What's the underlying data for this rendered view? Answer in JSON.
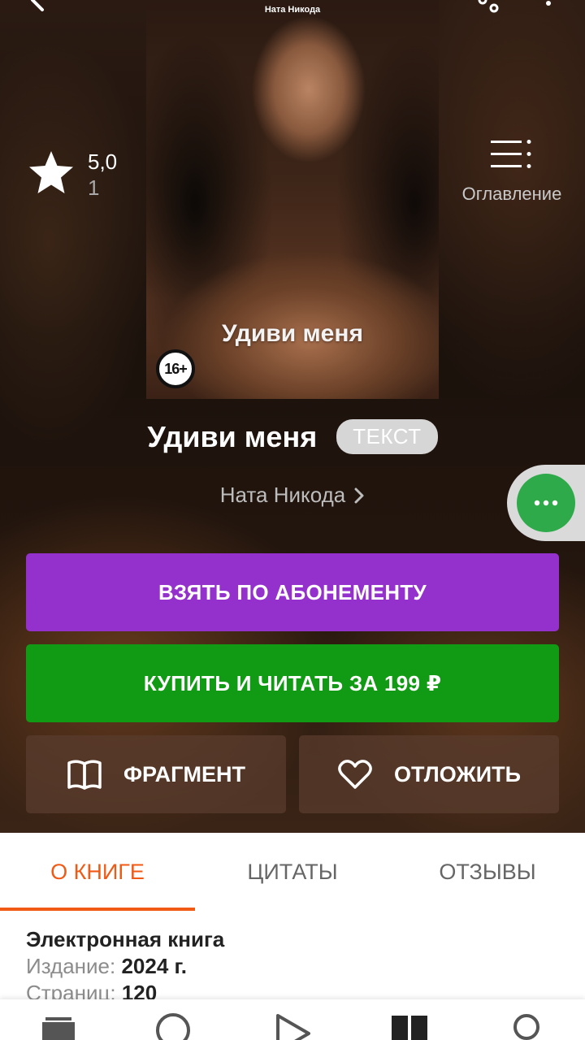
{
  "cover": {
    "author": "Ната Никода",
    "title": "Удиви меня",
    "age_rating": "16+"
  },
  "rating": {
    "value": "5,0",
    "count": "1"
  },
  "toc": {
    "label": "Оглавление"
  },
  "book": {
    "title": "Удиви меня",
    "type_badge": "ТЕКСТ",
    "author": "Ната Никода"
  },
  "actions": {
    "subscription": "ВЗЯТЬ ПО АБОНЕМЕНТУ",
    "buy": "КУПИТЬ И ЧИТАТЬ ЗА  199 ₽",
    "fragment": "ФРАГМЕНТ",
    "later": "ОТЛОЖИТЬ"
  },
  "tabs": [
    {
      "label": "О КНИГЕ",
      "active": true
    },
    {
      "label": "ЦИТАТЫ",
      "active": false
    },
    {
      "label": "ОТЗЫВЫ",
      "active": false
    }
  ],
  "details": {
    "heading": "Электронная книга",
    "edition_label": "Издание:",
    "edition_value": "2024 г.",
    "pages_label": "Страниц:",
    "pages_value": "120"
  },
  "colors": {
    "subscription": "#9431cc",
    "buy": "#119a13",
    "accent": "#f05a14",
    "float": "#2eaa4a"
  },
  "icons": {
    "top": [
      "back-icon",
      "share-icon",
      "more-vertical-icon"
    ],
    "nav": [
      "my-books-icon",
      "search-icon",
      "play-icon",
      "catalog-icon",
      "profile-icon"
    ]
  }
}
